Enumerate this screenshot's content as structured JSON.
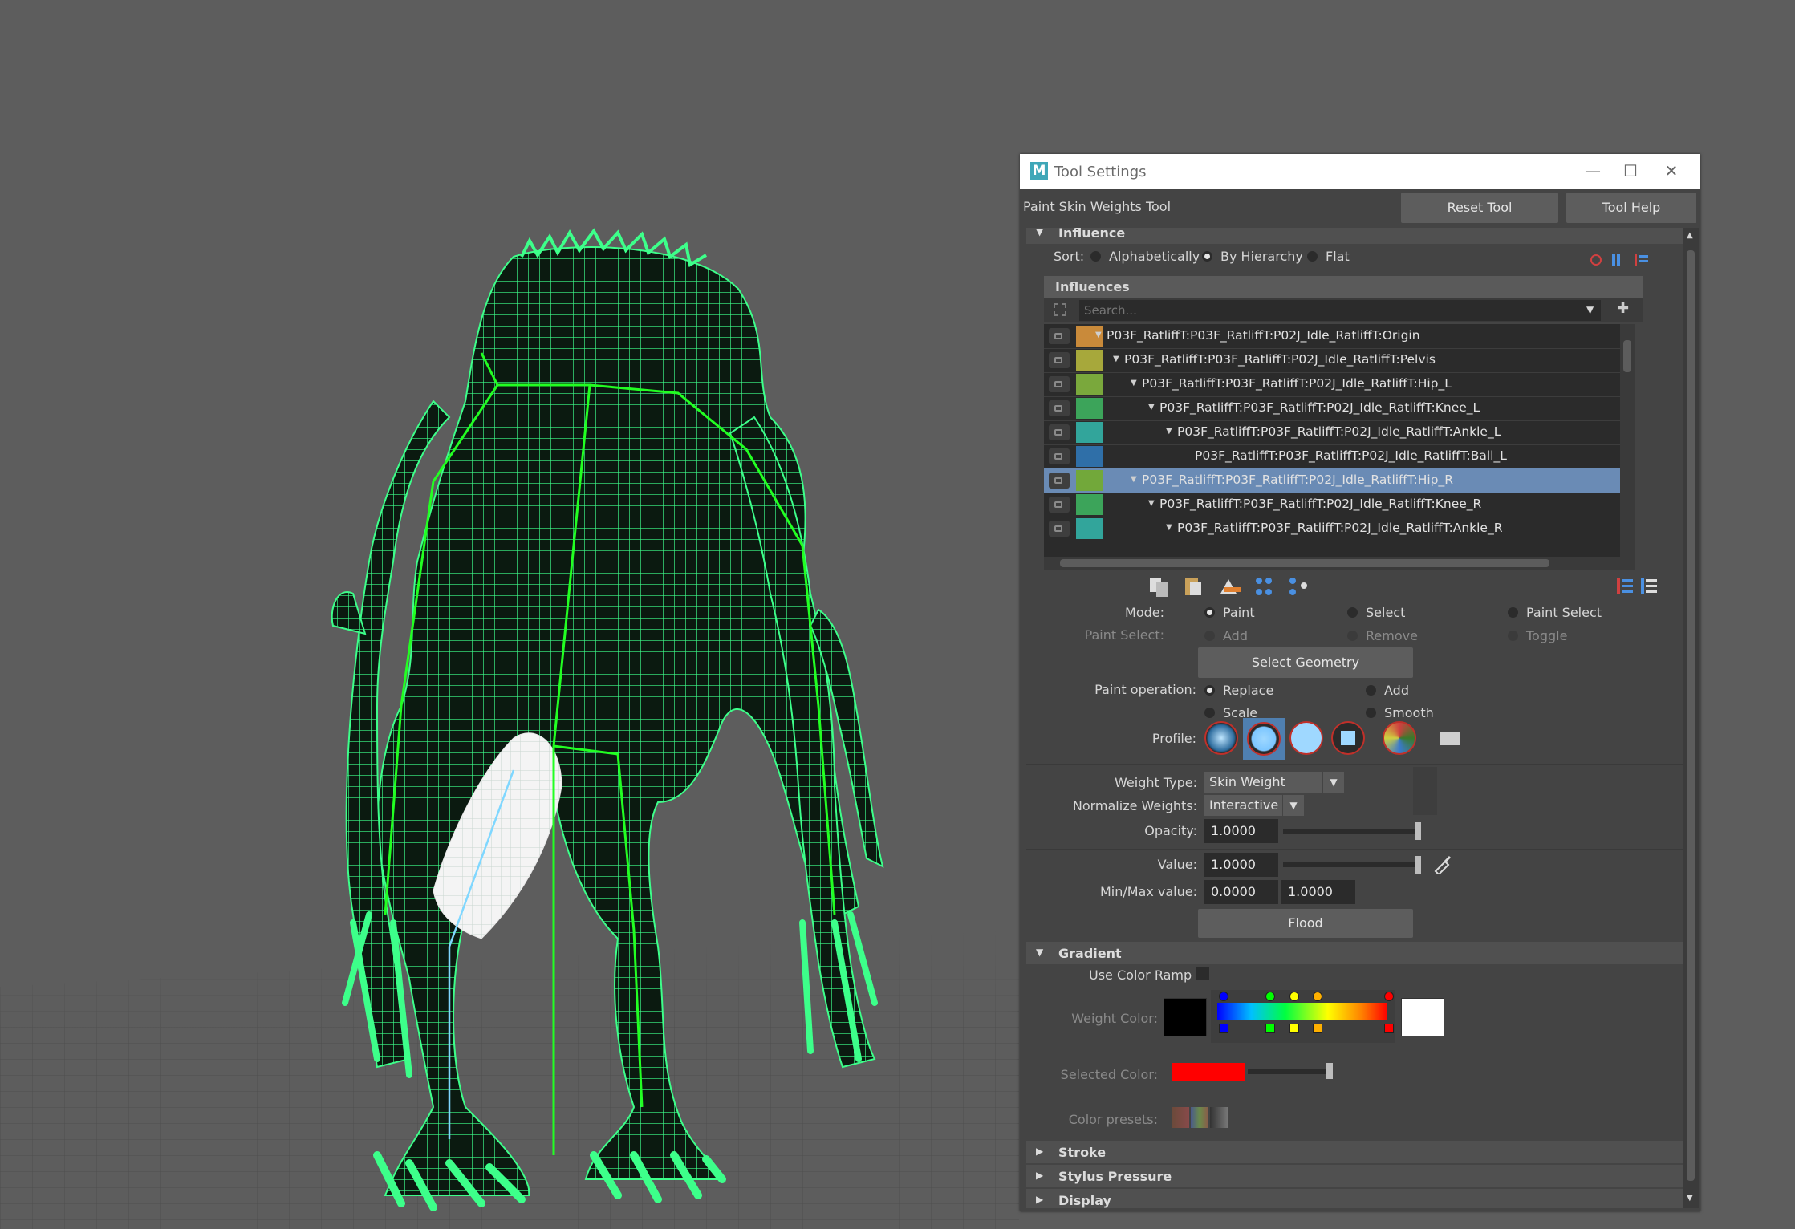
{
  "window": {
    "title": "Tool Settings",
    "minimize": "—",
    "maximize": "☐",
    "close": "✕"
  },
  "tool": {
    "name": "Paint Skin Weights Tool",
    "reset_label": "Reset Tool",
    "help_label": "Tool Help"
  },
  "influence_section": {
    "title": "Influence",
    "sort_label": "Sort:",
    "sort_options": [
      "Alphabetically",
      "By Hierarchy",
      "Flat"
    ],
    "sort_selected": "By Hierarchy",
    "list_header": "Influences",
    "search_placeholder": "Search...",
    "items": [
      {
        "name": "P03F_RatliffT:P03F_RatliffT:P02J_Idle_RatliffT:Origin",
        "color": "#c98a3a",
        "selected": false
      },
      {
        "name": "P03F_RatliffT:P03F_RatliffT:P02J_Idle_RatliffT:Pelvis",
        "color": "#a7a83b",
        "selected": false
      },
      {
        "name": "P03F_RatliffT:P03F_RatliffT:P02J_Idle_RatliffT:Hip_L",
        "color": "#7aa83c",
        "selected": false
      },
      {
        "name": "P03F_RatliffT:P03F_RatliffT:P02J_Idle_RatliffT:Knee_L",
        "color": "#3ca45a",
        "selected": false
      },
      {
        "name": "P03F_RatliffT:P03F_RatliffT:P02J_Idle_RatliffT:Ankle_L",
        "color": "#32a59b",
        "selected": false
      },
      {
        "name": "P03F_RatliffT:P03F_RatliffT:P02J_Idle_RatliffT:Ball_L",
        "color": "#2f6fa8",
        "selected": false
      },
      {
        "name": "P03F_RatliffT:P03F_RatliffT:P02J_Idle_RatliffT:Hip_R",
        "color": "#72a83a",
        "selected": true
      },
      {
        "name": "P03F_RatliffT:P03F_RatliffT:P02J_Idle_RatliffT:Knee_R",
        "color": "#3ca45a",
        "selected": false
      },
      {
        "name": "P03F_RatliffT:P03F_RatliffT:P02J_Idle_RatliffT:Ankle_R",
        "color": "#32a59b",
        "selected": false
      }
    ]
  },
  "mode": {
    "label": "Mode:",
    "options": [
      "Paint",
      "Select",
      "Paint Select"
    ],
    "selected": "Paint",
    "paint_select_label": "Paint Select:",
    "paint_select_options": [
      "Add",
      "Remove",
      "Toggle"
    ],
    "select_geometry_label": "Select Geometry"
  },
  "paint_operation": {
    "label": "Paint operation:",
    "options": [
      "Replace",
      "Add",
      "Scale",
      "Smooth"
    ],
    "selected": "Replace"
  },
  "profile": {
    "label": "Profile:",
    "icons": [
      "gaussian-brush-icon",
      "soft-brush-icon",
      "solid-brush-icon",
      "square-brush-icon",
      "texture-brush-icon",
      "folder-icon"
    ],
    "selected_index": 1
  },
  "weight_type": {
    "label": "Weight Type:",
    "value": "Skin Weight"
  },
  "normalize_weights": {
    "label": "Normalize Weights:",
    "value": "Interactive"
  },
  "opacity": {
    "label": "Opacity:",
    "value": "1.0000",
    "level": 1.0
  },
  "value": {
    "label": "Value:",
    "value": "1.0000",
    "level": 1.0
  },
  "minmax": {
    "label": "Min/Max value:",
    "min": "0.0000",
    "max": "1.0000"
  },
  "flood_label": "Flood",
  "gradient": {
    "title": "Gradient",
    "use_color_ramp_label": "Use Color Ramp",
    "weight_color_label": "Weight Color:",
    "selected_color_label": "Selected Color:",
    "selected_color": "#ff0000",
    "color_presets_label": "Color presets:",
    "ramp_markers": [
      "#0000ff",
      "#00ff00",
      "#ffff00",
      "#ffb000",
      "#ff0000"
    ]
  },
  "collapsed_sections": [
    "Stroke",
    "Stylus Pressure",
    "Display"
  ],
  "colors": {
    "mesh_wire": "#3dff8a",
    "bone": "#22ff22",
    "selected_weight": "#ffffff",
    "background": "#5d5d5d"
  }
}
